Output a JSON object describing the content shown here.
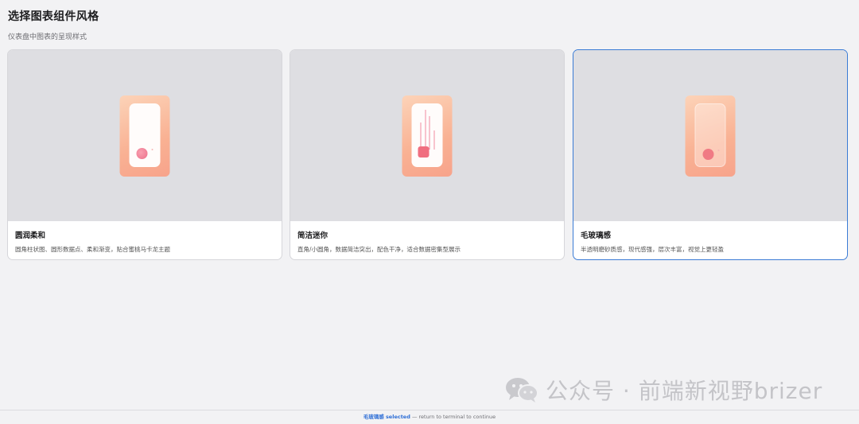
{
  "header": {
    "title": "选择图表组件风格",
    "subtitle": "仪表盘中图表的呈现样式"
  },
  "options": [
    {
      "name": "圆润柔和",
      "desc": "圆角柱状图、圆形数据点、柔和渐变，贴合蜜桃马卡龙主题",
      "selected": false
    },
    {
      "name": "简洁迷你",
      "desc": "直角/小圆角，数据简洁突出，配色干净，适合数据密集型展示",
      "selected": false
    },
    {
      "name": "毛玻璃感",
      "desc": "半透明磨砂质感，现代感强，层次丰富，视觉上更轻盈",
      "selected": true
    }
  ],
  "footer": {
    "selected_name": "毛玻璃感",
    "selected_word": "selected",
    "hint": " — return to terminal to continue"
  },
  "watermark": {
    "text": "公众号 · 前端新视野brizer"
  },
  "colors": {
    "accent": "#3a7bd5",
    "peach_light": "#fcd3b8",
    "peach_dark": "#f7a38b",
    "pink": "#ec6f8a"
  }
}
